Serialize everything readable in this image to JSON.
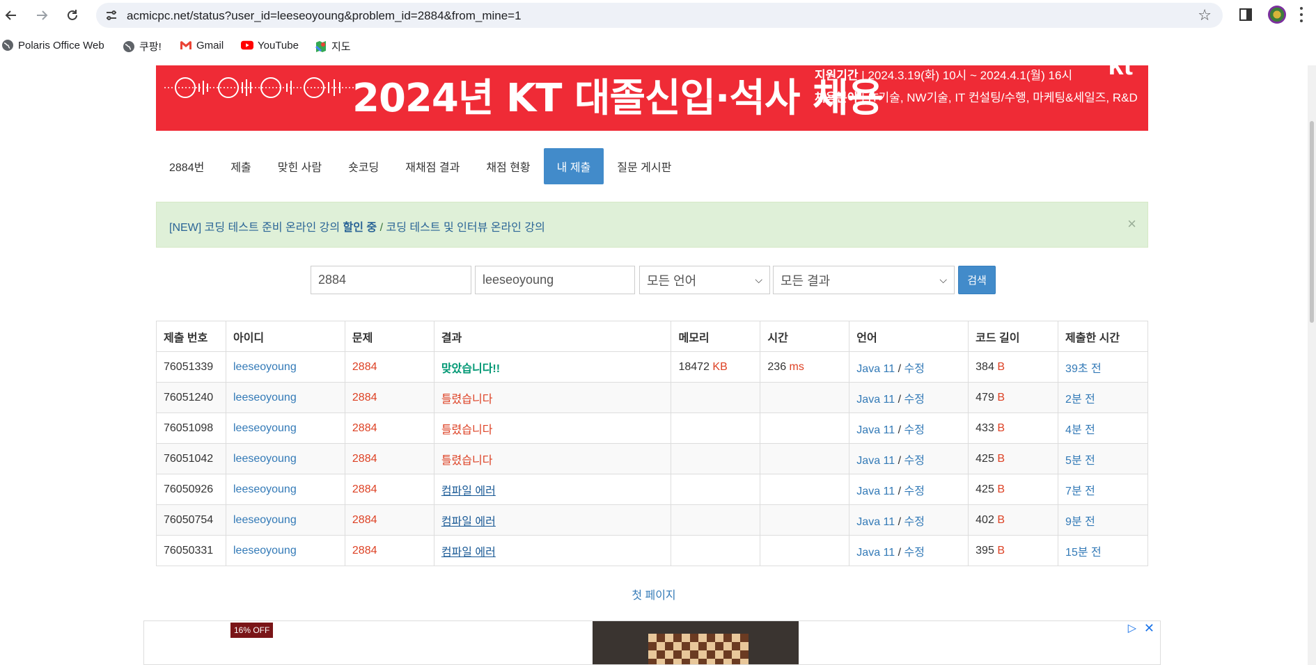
{
  "browser": {
    "url": "acmicpc.net/status?user_id=leeseoyoung&problem_id=2884&from_mine=1",
    "bookmarks": [
      {
        "label": "Polaris Office Web",
        "icon": "globe-icon"
      },
      {
        "label": "쿠팡!",
        "icon": "globe-icon"
      },
      {
        "label": "Gmail",
        "icon": "gmail-icon"
      },
      {
        "label": "YouTube",
        "icon": "youtube-icon"
      },
      {
        "label": "지도",
        "icon": "maps-icon"
      }
    ]
  },
  "banner": {
    "headline": "2024년 KT 대졸신입·석사 채용",
    "period_label": "지원기간",
    "period_value": "2024.3.19(화) 10시 ~ 2024.4.1(월) 16시",
    "field_label": "채용분야",
    "field_value": "IT기술, NW기술, IT 컨설팅/수행, 마케팅&세일즈, R&D",
    "logo": "kt",
    "color": "#ef2b36"
  },
  "tabs": [
    {
      "label": "2884번",
      "active": false
    },
    {
      "label": "제출",
      "active": false
    },
    {
      "label": "맞힌 사람",
      "active": false
    },
    {
      "label": "숏코딩",
      "active": false
    },
    {
      "label": "재채점 결과",
      "active": false
    },
    {
      "label": "채점 현황",
      "active": false
    },
    {
      "label": "내 제출",
      "active": true
    },
    {
      "label": "질문 게시판",
      "active": false
    }
  ],
  "alert": {
    "part1": "[NEW] 코딩 테스트 준비 온라인 강의 ",
    "part1_bold": "할인 중",
    "separator": " / ",
    "part2": "코딩 테스트 및 인터뷰 온라인 강의",
    "close": "×"
  },
  "search": {
    "problem_id": "2884",
    "user_id": "leeseoyoung",
    "language": "모든 언어",
    "result": "모든 결과",
    "button": "검색"
  },
  "table": {
    "headers": [
      "제출 번호",
      "아이디",
      "문제",
      "결과",
      "메모리",
      "시간",
      "언어",
      "코드 길이",
      "제출한 시간"
    ],
    "rows": [
      {
        "id": "76051339",
        "user": "leeseoyoung",
        "problem": "2884",
        "result": "맞았습니다!!",
        "result_type": "ac",
        "memory": "18472",
        "memory_unit": "KB",
        "time": "236",
        "time_unit": "ms",
        "lang": "Java 11",
        "edit": "수정",
        "length": "384",
        "length_unit": "B",
        "submitted": "39초 전"
      },
      {
        "id": "76051240",
        "user": "leeseoyoung",
        "problem": "2884",
        "result": "틀렸습니다",
        "result_type": "wa",
        "memory": "",
        "memory_unit": "",
        "time": "",
        "time_unit": "",
        "lang": "Java 11",
        "edit": "수정",
        "length": "479",
        "length_unit": "B",
        "submitted": "2분 전"
      },
      {
        "id": "76051098",
        "user": "leeseoyoung",
        "problem": "2884",
        "result": "틀렸습니다",
        "result_type": "wa",
        "memory": "",
        "memory_unit": "",
        "time": "",
        "time_unit": "",
        "lang": "Java 11",
        "edit": "수정",
        "length": "433",
        "length_unit": "B",
        "submitted": "4분 전"
      },
      {
        "id": "76051042",
        "user": "leeseoyoung",
        "problem": "2884",
        "result": "틀렸습니다",
        "result_type": "wa",
        "memory": "",
        "memory_unit": "",
        "time": "",
        "time_unit": "",
        "lang": "Java 11",
        "edit": "수정",
        "length": "425",
        "length_unit": "B",
        "submitted": "5분 전"
      },
      {
        "id": "76050926",
        "user": "leeseoyoung",
        "problem": "2884",
        "result": "컴파일 에러",
        "result_type": "ce",
        "memory": "",
        "memory_unit": "",
        "time": "",
        "time_unit": "",
        "lang": "Java 11",
        "edit": "수정",
        "length": "425",
        "length_unit": "B",
        "submitted": "7분 전"
      },
      {
        "id": "76050754",
        "user": "leeseoyoung",
        "problem": "2884",
        "result": "컴파일 에러",
        "result_type": "ce",
        "memory": "",
        "memory_unit": "",
        "time": "",
        "time_unit": "",
        "lang": "Java 11",
        "edit": "수정",
        "length": "402",
        "length_unit": "B",
        "submitted": "9분 전"
      },
      {
        "id": "76050331",
        "user": "leeseoyoung",
        "problem": "2884",
        "result": "컴파일 에러",
        "result_type": "ce",
        "memory": "",
        "memory_unit": "",
        "time": "",
        "time_unit": "",
        "lang": "Java 11",
        "edit": "수정",
        "length": "395",
        "length_unit": "B",
        "submitted": "15분 전"
      }
    ]
  },
  "pager": {
    "first_page": "첫 페이지"
  },
  "ad": {
    "badge": "16% OFF",
    "adchoice_icon": "adchoices-icon",
    "close": "✕"
  },
  "colors": {
    "accent": "#428bca",
    "alert_bg": "#dff0d8",
    "wrong": "#dd4124",
    "accepted": "#009874"
  }
}
